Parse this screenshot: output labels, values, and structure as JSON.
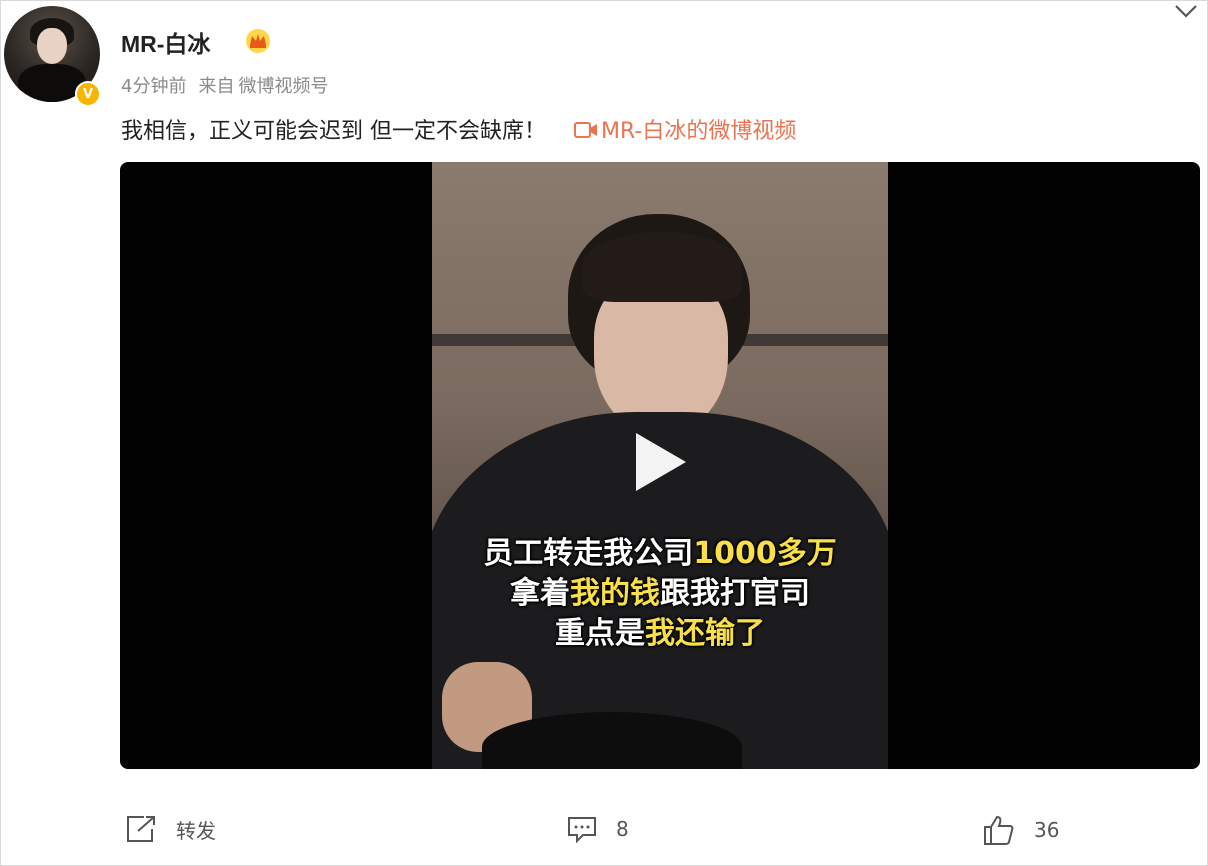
{
  "post": {
    "username": "MR-白冰",
    "time": "4分钟前",
    "source_prefix": "来自",
    "source": "微博视频号",
    "text": "我相信，正义可能会迟到 但一定不会缺席！",
    "video_link": "MR-白冰的微博视频",
    "verified_badge": "V"
  },
  "video": {
    "subtitle_line1_a": "员工转走我公司",
    "subtitle_line1_b": "1000多万",
    "subtitle_line2_a": "拿着",
    "subtitle_line2_b": "我的钱",
    "subtitle_line2_c": "跟我打官司",
    "subtitle_line3_a": "重点是",
    "subtitle_line3_b": "我还输了"
  },
  "actions": {
    "repost_label": "转发",
    "comment_count": "8",
    "like_count": "36"
  },
  "colors": {
    "link": "#eb7350",
    "badge": "#f7b500",
    "subtitle_highlight": "#f9e04b"
  },
  "icons": [
    "avatar",
    "verified-badge-icon",
    "crown-icon",
    "chevron-down-icon",
    "video-link-icon",
    "play-icon",
    "repost-icon",
    "comment-icon",
    "like-icon"
  ]
}
